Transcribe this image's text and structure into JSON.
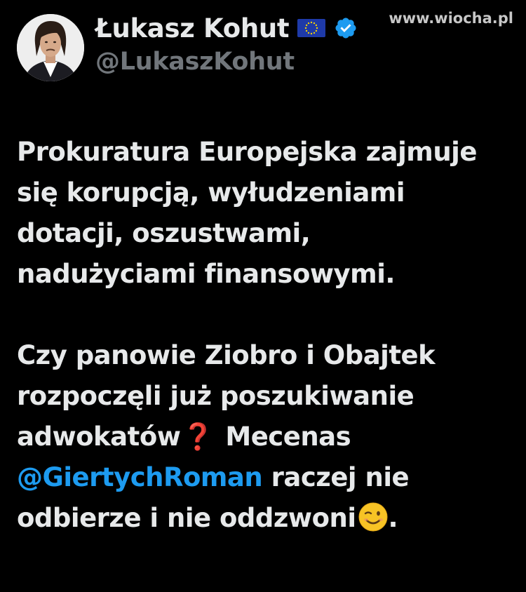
{
  "watermark": "www.wiocha.pl",
  "author": {
    "display_name": "Łukasz Kohut",
    "handle": "@LukaszKohut",
    "flag_icon": "eu-flag-icon",
    "verified_icon": "verified-badge-icon"
  },
  "tweet": {
    "paragraph1": [
      "Prokuratura Europejska zajmuje",
      "się korupcją, wyłudzeniami",
      "dotacji, oszustwami,",
      "nadużyciami finansowymi."
    ],
    "paragraph2": {
      "line1": "Czy panowie Ziobro i Obajtek",
      "line2": "rozpoczęli już poszukiwanie",
      "line3_a": "adwokatów",
      "line3_emoji": "❓",
      "line3_b": "Mecenas",
      "line4_mention": "@GiertychRoman",
      "line4_b": " raczej nie",
      "line5_a": "odbierze i nie oddzwoni",
      "line5_end": "."
    }
  },
  "colors": {
    "background": "#000000",
    "text": "#e7e9ea",
    "secondary": "#71767b",
    "mention": "#1d9bf0",
    "verified": "#1d9bf0",
    "eu_blue": "#1e3aa8",
    "eu_star": "#f5d100"
  }
}
